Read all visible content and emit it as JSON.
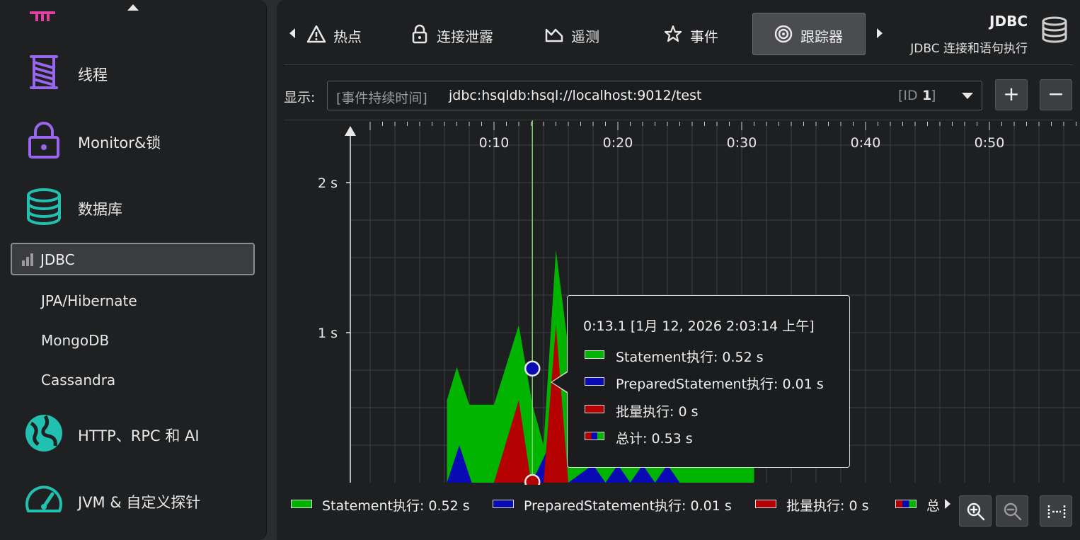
{
  "sidebar": {
    "items": [
      {
        "label": "线程",
        "icon": "spool-icon"
      },
      {
        "label": "Monitor&锁",
        "icon": "lock-icon"
      },
      {
        "label": "数据库",
        "icon": "database-icon"
      },
      {
        "label": "HTTP、RPC 和 AI",
        "icon": "globe-icon"
      },
      {
        "label": "JVM & 自定义探针",
        "icon": "gauge-icon"
      }
    ],
    "selected": {
      "label": "JDBC",
      "icon": "bars-icon"
    },
    "sub_items": [
      "JPA/Hibernate",
      "MongoDB",
      "Cassandra"
    ]
  },
  "tabs": [
    {
      "label": "热点",
      "icon": "warning-icon"
    },
    {
      "label": "连接泄露",
      "icon": "lock-icon"
    },
    {
      "label": "遥测",
      "icon": "telemetry-icon"
    },
    {
      "label": "事件",
      "icon": "star-icon"
    },
    {
      "label": "跟踪器",
      "icon": "tracker-icon",
      "active": true
    }
  ],
  "header": {
    "title": "JDBC",
    "subtitle": "JDBC 连接和语句执行"
  },
  "display": {
    "label": "显示:",
    "prefix": "[事件持续时间]",
    "value": "jdbc:hsqldb:hsql://localhost:9012/test",
    "id_label": "[ID",
    "id_value": "1",
    "id_close": "]"
  },
  "buttons": {
    "add": "+",
    "remove": "−"
  },
  "colors": {
    "statement": "#00b400",
    "prepared": "#0a0ab4",
    "batch": "#b40000",
    "background": "#1e1f21"
  },
  "tooltip": {
    "time": "0:13.1 [1月 12, 2026 2:03:14 上午]",
    "rows": [
      {
        "label": "Statement执行:  0.52 s"
      },
      {
        "label": "PreparedStatement执行:  0.01 s"
      },
      {
        "label": "批量执行:  0 s"
      },
      {
        "label": "总计:  0.53 s"
      }
    ]
  },
  "legend": [
    {
      "label": "Statement执行:  0.52 s"
    },
    {
      "label": "PreparedStatement执行:  0.01 s"
    },
    {
      "label": "批量执行:  0 s"
    },
    {
      "label": "总"
    }
  ],
  "chart_data": {
    "type": "area",
    "x_ticks": [
      "0:10",
      "0:20",
      "0:30",
      "0:40",
      "0:50"
    ],
    "y_ticks": [
      "1 s",
      "2 s"
    ],
    "ylim": [
      0,
      2.4
    ],
    "xlim_seconds": [
      0,
      58
    ],
    "cursor_x": 13.1,
    "series": [
      {
        "name": "Statement执行",
        "x": [
          6.2,
          6.2,
          7.0,
          8.0,
          10.0,
          12.0,
          13.1,
          14.0,
          15.0,
          16.0,
          17.0,
          18.0,
          20.0,
          22.0,
          24.0,
          26.0,
          28.0,
          31.0,
          31.0
        ],
        "y": [
          0,
          0.55,
          0.77,
          0.52,
          0.52,
          1.05,
          0.52,
          0.25,
          1.55,
          0.9,
          0.4,
          0.3,
          0.1,
          0.1,
          0.1,
          0.1,
          0.1,
          0.1,
          0
        ]
      },
      {
        "name": "PreparedStatement执行",
        "x": [
          6.2,
          7.2,
          8.2,
          10.0,
          11.0,
          12.0,
          13.1,
          14.2,
          15.2,
          16.0,
          18.0,
          19.0,
          20.0,
          21.0,
          22.0,
          23.0,
          24.0,
          25.0,
          26.0
        ],
        "y": [
          0,
          0.25,
          0,
          0,
          0.25,
          0,
          0.01,
          0.2,
          0,
          0,
          0.12,
          0,
          0.12,
          0,
          0.12,
          0,
          0.12,
          0,
          0
        ]
      },
      {
        "name": "批量执行",
        "x": [
          10.0,
          12.0,
          13.0,
          14.0,
          15.0,
          16.0,
          16.5
        ],
        "y": [
          0,
          0.55,
          0,
          0,
          1.05,
          0,
          0
        ]
      }
    ]
  }
}
